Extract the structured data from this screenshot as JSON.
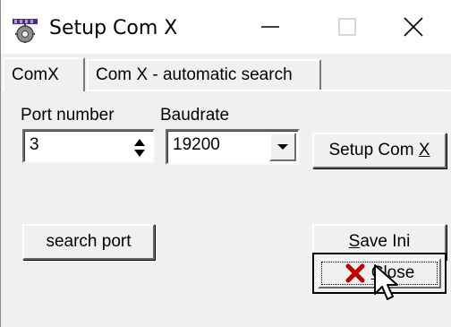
{
  "window": {
    "title": "Setup Com X",
    "icon": "app-setup-icon",
    "controls": [
      "minimize-icon",
      "maximize-icon",
      "close-icon"
    ]
  },
  "tabs": [
    {
      "label": "ComX",
      "active": true
    },
    {
      "label": "Com X - automatic search",
      "active": false
    }
  ],
  "form": {
    "port_label": "Port number",
    "port_value": "3",
    "baudrate_label": "Baudrate",
    "baudrate_value": "19200"
  },
  "buttons": {
    "setup_com_pre": "Setup Com ",
    "setup_com_key": "X",
    "search_port": "search port",
    "save_ini_key": "S",
    "save_ini_rest": "ave Ini",
    "close_key": "C",
    "close_rest": "lose"
  },
  "colors": {
    "close_x": "#c00000",
    "face": "#f0f0f0"
  }
}
